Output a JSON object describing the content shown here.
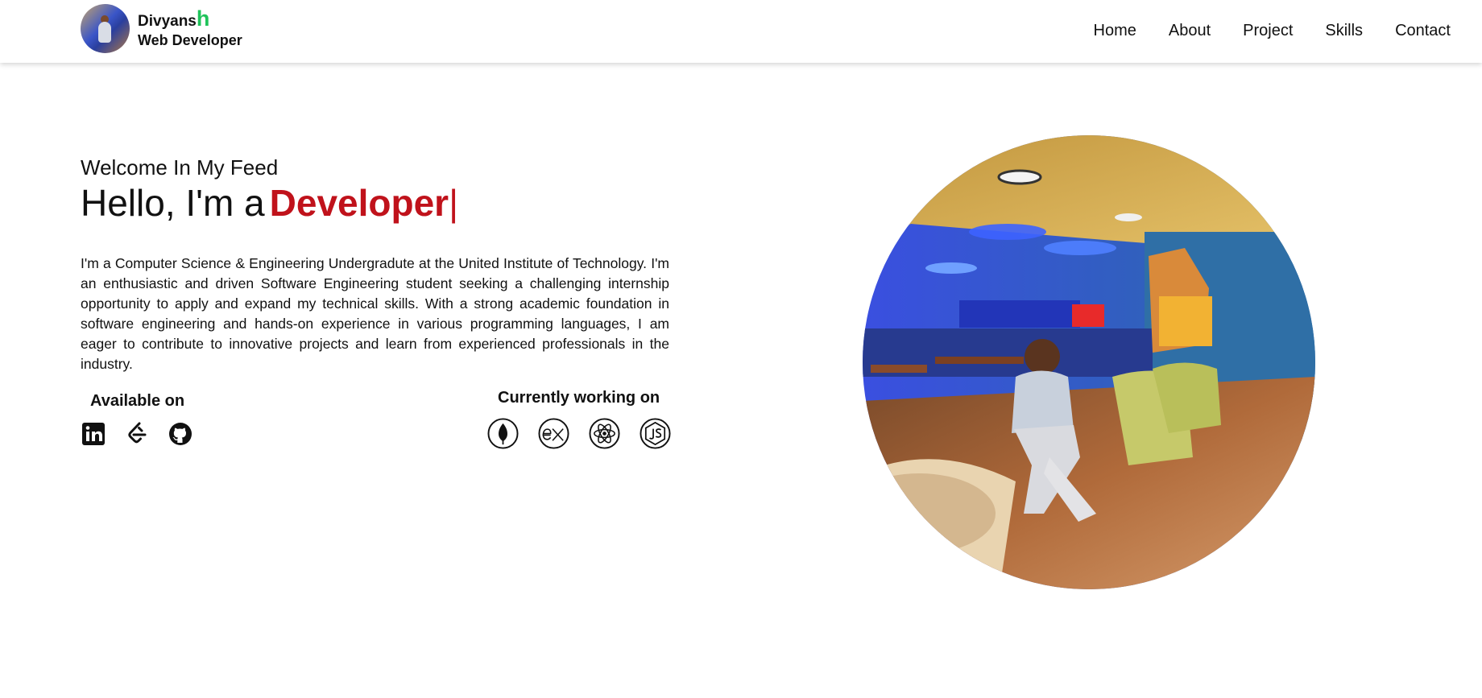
{
  "header": {
    "brand": {
      "name_main": "Divyans",
      "name_accent": "h",
      "role": "Web Developer"
    },
    "nav": [
      "Home",
      "About",
      "Project",
      "Skills",
      "Contact"
    ]
  },
  "hero": {
    "welcome": "Welcome In My Feed",
    "hello_prefix": "Hello, I'm a",
    "role_word": "Developer",
    "cursor": "|",
    "bio": "I'm a Computer Science & Engineering Undergradute at the United Institute of Technology. I'm an enthusiastic and driven Software Engineering student seeking a challenging internship opportunity to apply and expand my technical skills. With a strong academic foundation in software engineering and hands-on experience in various programming languages, I am eager to contribute to innovative projects and learn from experienced professionals in the industry.",
    "available_title": "Available on",
    "available_icons": [
      "linkedin-icon",
      "leetcode-icon",
      "github-icon"
    ],
    "working_title": "Currently working on",
    "working_icons": [
      "mongodb-icon",
      "express-icon",
      "react-icon",
      "nodejs-icon"
    ]
  },
  "colors": {
    "accent_red": "#c0121b",
    "accent_green": "#1fc35a"
  }
}
